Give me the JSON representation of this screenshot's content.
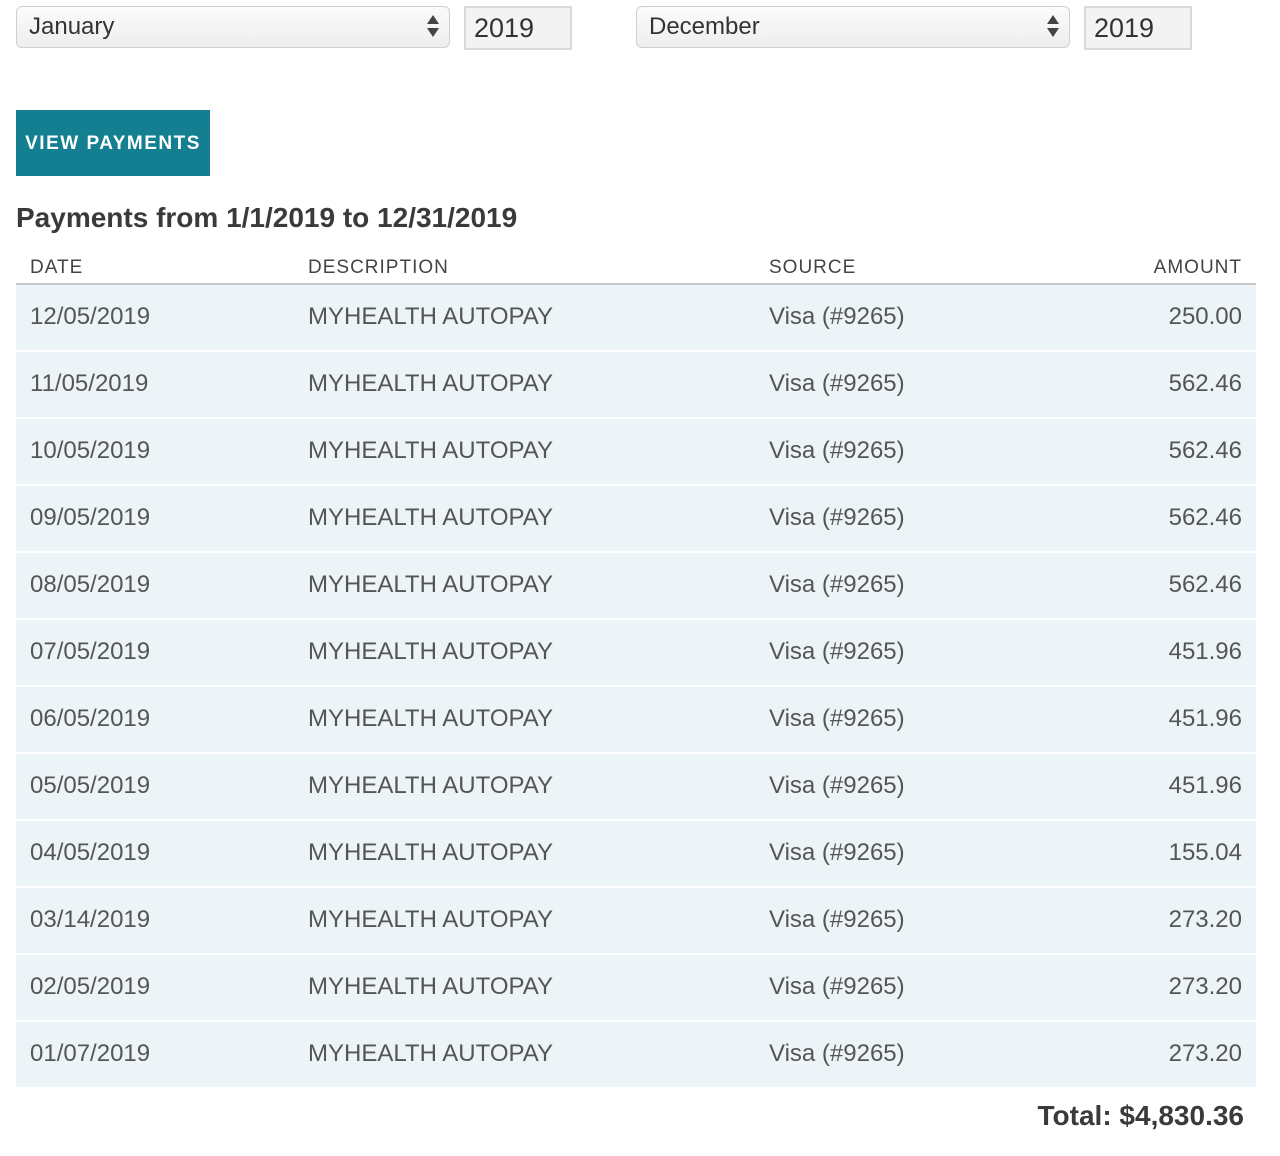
{
  "filters": {
    "from_month": "January",
    "from_year": "2019",
    "to_month": "December",
    "to_year": "2019"
  },
  "view_button": "VIEW PAYMENTS",
  "heading": "Payments from 1/1/2019 to 12/31/2019",
  "columns": {
    "date": "DATE",
    "description": "DESCRIPTION",
    "source": "SOURCE",
    "amount": "AMOUNT"
  },
  "payments": [
    {
      "date": "12/05/2019",
      "description": "MYHEALTH AUTOPAY",
      "source": "Visa (#9265)",
      "amount": "250.00"
    },
    {
      "date": "11/05/2019",
      "description": "MYHEALTH AUTOPAY",
      "source": "Visa (#9265)",
      "amount": "562.46"
    },
    {
      "date": "10/05/2019",
      "description": "MYHEALTH AUTOPAY",
      "source": "Visa (#9265)",
      "amount": "562.46"
    },
    {
      "date": "09/05/2019",
      "description": "MYHEALTH AUTOPAY",
      "source": "Visa (#9265)",
      "amount": "562.46"
    },
    {
      "date": "08/05/2019",
      "description": "MYHEALTH AUTOPAY",
      "source": "Visa (#9265)",
      "amount": "562.46"
    },
    {
      "date": "07/05/2019",
      "description": "MYHEALTH AUTOPAY",
      "source": "Visa (#9265)",
      "amount": "451.96"
    },
    {
      "date": "06/05/2019",
      "description": "MYHEALTH AUTOPAY",
      "source": "Visa (#9265)",
      "amount": "451.96"
    },
    {
      "date": "05/05/2019",
      "description": "MYHEALTH AUTOPAY",
      "source": "Visa (#9265)",
      "amount": "451.96"
    },
    {
      "date": "04/05/2019",
      "description": "MYHEALTH AUTOPAY",
      "source": "Visa (#9265)",
      "amount": "155.04"
    },
    {
      "date": "03/14/2019",
      "description": "MYHEALTH AUTOPAY",
      "source": "Visa (#9265)",
      "amount": "273.20"
    },
    {
      "date": "02/05/2019",
      "description": "MYHEALTH AUTOPAY",
      "source": "Visa (#9265)",
      "amount": "273.20"
    },
    {
      "date": "01/07/2019",
      "description": "MYHEALTH AUTOPAY",
      "source": "Visa (#9265)",
      "amount": "273.20"
    }
  ],
  "total": "Total: $4,830.36",
  "colors": {
    "accent": "#137f91",
    "row_background": "#edf4f7"
  }
}
